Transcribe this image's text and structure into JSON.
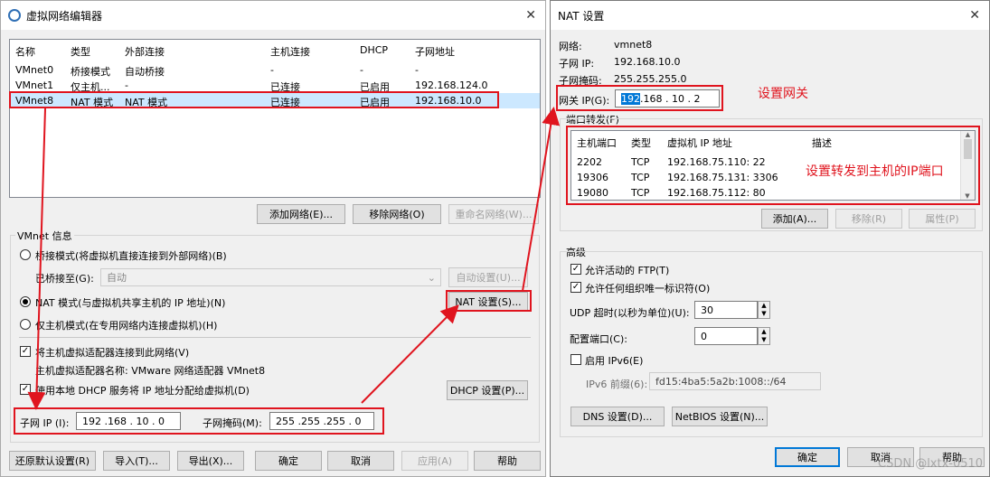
{
  "left": {
    "title": "虚拟网络编辑器",
    "columns": [
      "名称",
      "类型",
      "外部连接",
      "主机连接",
      "DHCP",
      "子网地址"
    ],
    "rows": [
      [
        "VMnet0",
        "桥接模式",
        "自动桥接",
        "-",
        "-",
        "-"
      ],
      [
        "VMnet1",
        "仅主机...",
        "-",
        "已连接",
        "已启用",
        "192.168.124.0"
      ],
      [
        "VMnet8",
        "NAT 模式",
        "NAT 模式",
        "已连接",
        "已启用",
        "192.168.10.0"
      ]
    ],
    "add_network": "添加网络(E)...",
    "remove_network": "移除网络(O)",
    "rename_network": "重命名网络(W)...",
    "group_label": "VMnet 信息",
    "bridge_mode": "桥接模式(将虚拟机直接连接到外部网络)(B)",
    "bridged_to_label": "已桥接至(G):",
    "bridged_to_value": "自动",
    "auto_settings": "自动设置(U)...",
    "nat_mode": "NAT 模式(与虚拟机共享主机的 IP 地址)(N)",
    "nat_settings": "NAT 设置(S)...",
    "host_only": "仅主机模式(在专用网络内连接虚拟机)(H)",
    "connect_adapter": "将主机虚拟适配器连接到此网络(V)",
    "adapter_name": "主机虚拟适配器名称: VMware 网络适配器 VMnet8",
    "use_dhcp": "使用本地 DHCP 服务将 IP 地址分配给虚拟机(D)",
    "dhcp_settings": "DHCP 设置(P)...",
    "subnet_ip_label": "子网 IP (I):",
    "subnet_ip_value": "192 .168 . 10 . 0",
    "subnet_mask_label": "子网掩码(M):",
    "subnet_mask_value": "255 .255 .255 . 0",
    "restore_defaults": "还原默认设置(R)",
    "import": "导入(T)...",
    "export": "导出(X)...",
    "ok": "确定",
    "cancel": "取消",
    "apply": "应用(A)",
    "help": "帮助"
  },
  "right": {
    "title": "NAT 设置",
    "network_label": "网络:",
    "network_value": "vmnet8",
    "subnet_ip_label": "子网 IP:",
    "subnet_ip_value": "192.168.10.0",
    "subnet_mask_label": "子网掩码:",
    "subnet_mask_value": "255.255.255.0",
    "gateway_label": "网关 IP(G):",
    "gateway_sel": "192",
    "gateway_rest": " .168 . 10 . 2",
    "port_forward_label": "端口转发(F)",
    "pf_columns": [
      "主机端口",
      "类型",
      "虚拟机 IP 地址",
      "描述"
    ],
    "pf_rows": [
      [
        "2202",
        "TCP",
        "192.168.75.110: 22"
      ],
      [
        "19306",
        "TCP",
        "192.168.75.131: 3306"
      ],
      [
        "19080",
        "TCP",
        "192.168.75.112: 80"
      ]
    ],
    "add": "添加(A)...",
    "remove": "移除(R)",
    "properties": "属性(P)",
    "advanced_label": "高级",
    "allow_ftp": "允许活动的 FTP(T)",
    "allow_org_id": "允许任何组织唯一标识符(O)",
    "udp_timeout_label": "UDP 超时(以秒为单位)(U):",
    "udp_timeout_value": "30",
    "config_port_label": "配置端口(C):",
    "config_port_value": "0",
    "enable_ipv6": "启用 IPv6(E)",
    "ipv6_prefix_label": "IPv6 前缀(6):",
    "ipv6_prefix_value": "fd15:4ba5:5a2b:1008::/64",
    "dns_settings": "DNS 设置(D)...",
    "netbios_settings": "NetBIOS 设置(N)...",
    "ok": "确定",
    "cancel": "取消",
    "help": "帮助"
  },
  "annotations": {
    "set_gateway": "设置网关",
    "set_forward": "设置转发到主机的IP端口"
  },
  "watermark": "CSDN @lxtx-0510",
  "colors": {
    "annotation_red": "#e0141e",
    "selection_blue": "#0078d7"
  }
}
